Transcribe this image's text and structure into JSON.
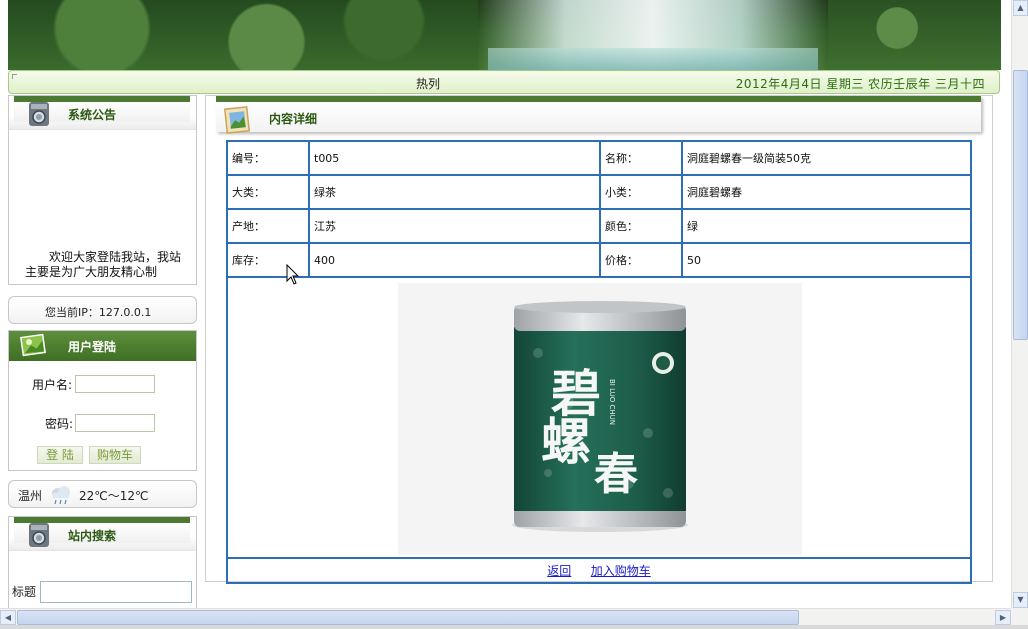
{
  "header": {
    "marquee_text": "热列",
    "date_text": "2012年4月4日  星期三  农历壬辰年  三月十四"
  },
  "sidebar": {
    "notice": {
      "title": "系统公告",
      "text": "欢迎大家登陆我站，我站主要是为广大朋友精心制"
    },
    "ip": {
      "text": "您当前IP：127.0.0.1"
    },
    "login": {
      "title": "用户登陆",
      "username_label": "用户名:",
      "username_value": "",
      "password_label": "密码:",
      "password_value": "",
      "login_button": "登 陆",
      "cart_button": "购物车"
    },
    "weather": {
      "city": "温州",
      "temperature": "22℃～12℃",
      "icon": "rain-cloud-icon"
    },
    "search": {
      "title": "站内搜索",
      "label": "标题",
      "value": ""
    }
  },
  "content": {
    "title": "内容详细",
    "fields": {
      "code_label": "编号：",
      "code_value": "t005",
      "name_label": "名称：",
      "name_value": "洞庭碧螺春一级简装50克",
      "category_label": "大类：",
      "category_value": "绿茶",
      "subcategory_label": "小类：",
      "subcategory_value": "洞庭碧螺春",
      "origin_label": "产地：",
      "origin_value": "江苏",
      "color_label": "颜色：",
      "color_value": "绿",
      "stock_label": "库存：",
      "stock_value": "400",
      "price_label": "价格：",
      "price_value": "50"
    },
    "product_image": {
      "can_text": "碧螺春",
      "can_subtext": "BI LUO CHUN",
      "colors": {
        "can": "#1f5b47",
        "lid": "#c9ccce"
      }
    },
    "actions": {
      "back": "返回",
      "add_to_cart": "加入购物车"
    }
  },
  "colors": {
    "accent": "#4c7a32",
    "table_border": "#2d6fb5",
    "link": "#1b1bc7"
  }
}
